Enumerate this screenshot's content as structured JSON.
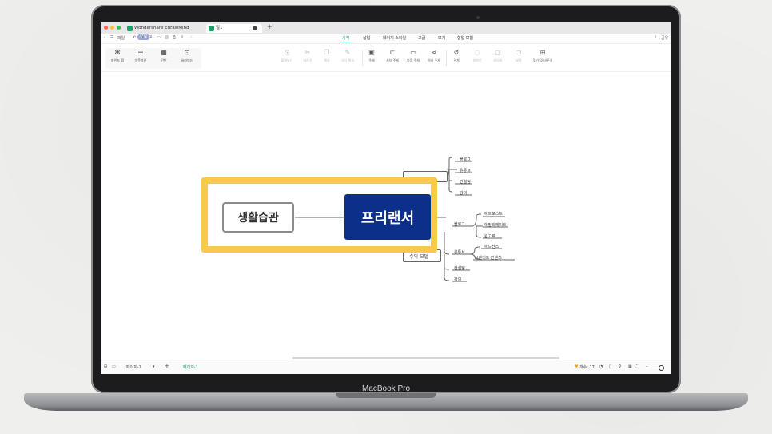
{
  "window": {
    "tabs": [
      {
        "label": "Wondershare EdrawMind",
        "badge": "무료"
      },
      {
        "label": "멀1"
      }
    ]
  },
  "toolbar_top": {
    "file_label": "파일"
  },
  "menu": {
    "items": [
      "시작",
      "삽입",
      "페이지 스타일",
      "고급",
      "보기",
      "협업 모험"
    ],
    "active": "시작",
    "share_label": "공유"
  },
  "view_modes": [
    {
      "icon": "mindmap-icon",
      "glyph": "⌘",
      "label": "마인드 맵"
    },
    {
      "icon": "outline-icon",
      "glyph": "☰",
      "label": "아웃라인"
    },
    {
      "icon": "presentation-icon",
      "glyph": "▦",
      "label": "간반"
    },
    {
      "icon": "slide-icon",
      "glyph": "⊡",
      "label": "슬라이드"
    }
  ],
  "ribbon_tools": [
    {
      "icon": "paste-icon",
      "glyph": "⎘",
      "label": "붙여넣기",
      "dim": true
    },
    {
      "icon": "cut-icon",
      "glyph": "✂",
      "label": "자르기",
      "dim": true
    },
    {
      "icon": "copy-icon",
      "glyph": "❐",
      "label": "복사",
      "dim": true
    },
    {
      "icon": "format-painter-icon",
      "glyph": "✎",
      "label": "서식 복사",
      "dim": true
    },
    {
      "icon": "topic-icon",
      "glyph": "▣",
      "label": "주제",
      "dim": false
    },
    {
      "icon": "subtopic-icon",
      "glyph": "⊏",
      "label": "서브 주제",
      "dim": false
    },
    {
      "icon": "floating-topic-icon",
      "glyph": "▭",
      "label": "부동 주제",
      "dim": false
    },
    {
      "icon": "multi-topic-icon",
      "glyph": "⋖",
      "label": "여러 주제",
      "dim": false
    },
    {
      "icon": "relation-icon",
      "glyph": "↺",
      "label": "관계",
      "dim": false
    },
    {
      "icon": "callout-icon",
      "glyph": "◌",
      "label": "설명선",
      "dim": true
    },
    {
      "icon": "boundary-icon",
      "glyph": "▢",
      "label": "테두리",
      "dim": true
    },
    {
      "icon": "summary-icon",
      "glyph": "⊐",
      "label": "요약",
      "dim": true
    },
    {
      "icon": "find-replace-icon",
      "glyph": "⊞",
      "label": "찾기 및 바꾸기",
      "dim": false
    }
  ],
  "mindmap": {
    "central": "프리랜서",
    "left_topic": "생활습관",
    "partial_right_label": "수익 모델",
    "branch1_leaves": [
      "블로그",
      "유튜브",
      "컨설팅",
      "강의"
    ],
    "mid_label": "블로그",
    "mid_leaves": [
      "애드포스트",
      "애필리에이트",
      "원고료"
    ],
    "youtube_label": "유튜브",
    "youtube_leaves": [
      "애드센스",
      "브랜디드 컨텐츠"
    ],
    "bottom_leaves": [
      "컨설팅",
      "강의"
    ]
  },
  "statusbar": {
    "page_tab": "페이지-1",
    "page_active": "페이지-1",
    "count_label": "개수: 17"
  },
  "device": {
    "label": "MacBook Pro"
  },
  "colors": {
    "central": "#0c2f8a",
    "highlight": "#f9c94e",
    "accent": "#1e9e6a"
  }
}
